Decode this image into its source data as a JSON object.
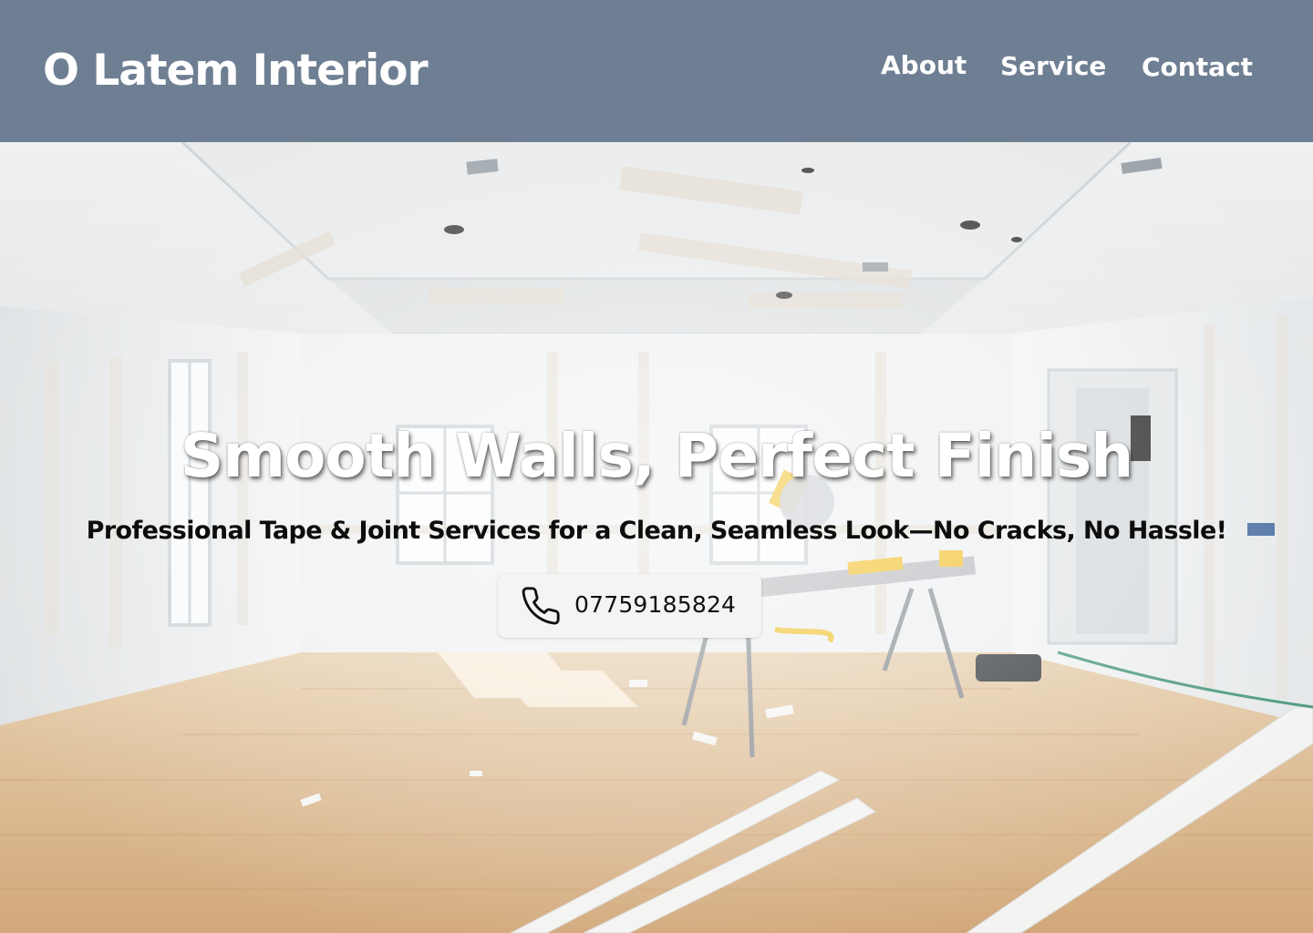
{
  "header": {
    "brand": "O Latem Interior",
    "nav": [
      {
        "label": "About"
      },
      {
        "label": "Service"
      },
      {
        "label": "Contact"
      }
    ]
  },
  "hero": {
    "title": "Smooth Walls, Perfect Finish",
    "subtitle": "Professional Tape & Joint Services for a Clean, Seamless Look—No Cracks, No Hassle!",
    "cta": {
      "icon": "phone-icon",
      "phone": "07759185824"
    }
  },
  "colors": {
    "header_bg": "#6f7f93",
    "header_text": "#ffffff",
    "button_bg": "#f4f4f4",
    "floor": "#d8b489",
    "walls": "#f0f1f2"
  }
}
